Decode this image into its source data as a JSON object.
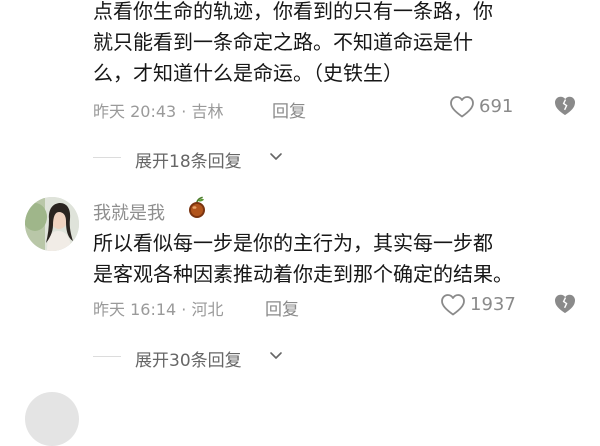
{
  "comment1": {
    "lines": [
      "点看你生命的轨迹，你看到的只有一条路，你",
      "就只能看到一条命定之路。不知道命运是什",
      "么，才知道什么是命运。（史铁生）"
    ],
    "time_location": "昨天 20:43 · 吉林",
    "reply_label": "回复",
    "like_count": "691",
    "expand_label": "展开18条回复"
  },
  "comment2": {
    "username": "我就是我",
    "lines": [
      "所以看似每一步是你的主行为，其实每一步都",
      "是客观各种因素推动着你走到那个确定的结果。"
    ],
    "time_location": "昨天 16:14 · 河北",
    "reply_label": "回复",
    "like_count": "1937",
    "expand_label": "展开30条回复"
  },
  "icons": {
    "like": "heart-outline-icon",
    "dislike": "broken-heart-icon",
    "expand": "chevron-down-icon",
    "badge": "fruit-badge-icon"
  },
  "colors": {
    "text": "#161616",
    "meta": "#9a9a9a",
    "icon": "#8a8a8a"
  }
}
